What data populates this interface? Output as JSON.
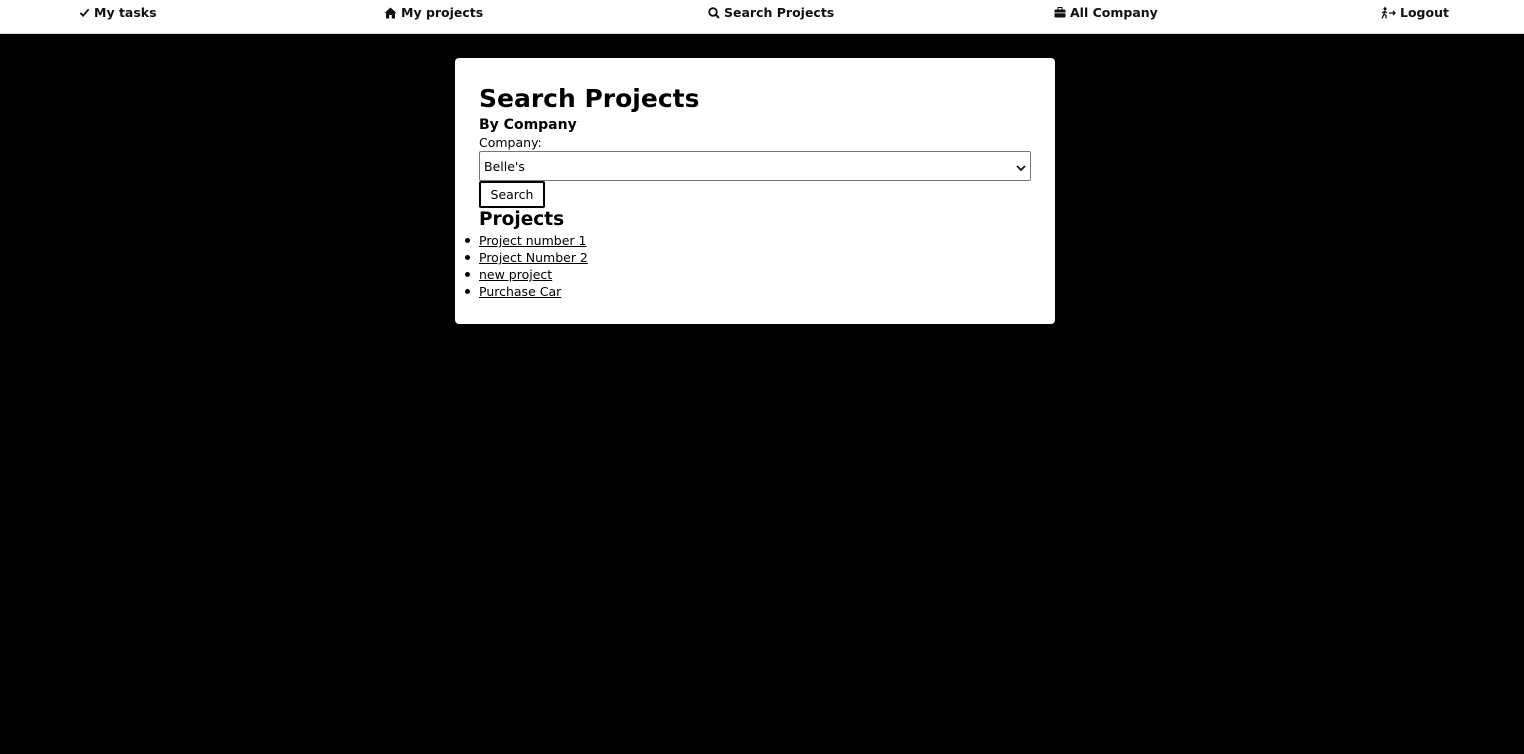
{
  "nav": {
    "items": [
      {
        "label": "My tasks",
        "icon": "check-icon"
      },
      {
        "label": "My projects",
        "icon": "home-icon"
      },
      {
        "label": "Search Projects",
        "icon": "search-icon"
      },
      {
        "label": "All Company",
        "icon": "briefcase-icon"
      },
      {
        "label": "Logout",
        "icon": "exit-icon"
      }
    ]
  },
  "main": {
    "title": "Search Projects",
    "subtitle": "By Company",
    "company_label": "Company:",
    "company_selected": "Belle's",
    "search_button": "Search",
    "projects_heading": "Projects",
    "projects": [
      "Project number 1",
      "Project Number 2",
      "new project",
      "Purchase Car"
    ]
  },
  "colors": {
    "background": "#000000",
    "card": "#ffffff",
    "text": "#000000"
  }
}
